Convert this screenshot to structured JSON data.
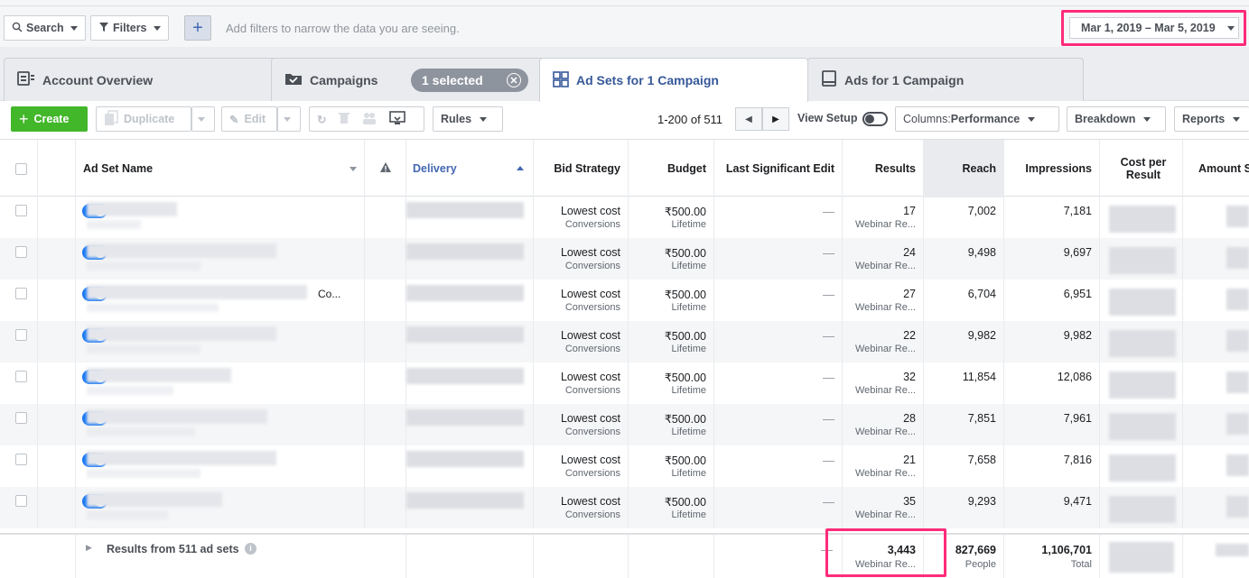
{
  "topbar": {
    "search_label": "Search",
    "filters_label": "Filters",
    "plus_label": "+",
    "filter_hint": "Add filters to narrow the data you are seeing.",
    "date_range": "Mar 1, 2019 – Mar 5, 2019"
  },
  "tabs": {
    "account_overview": "Account Overview",
    "campaigns": "Campaigns",
    "selected_pill": "1 selected",
    "ad_sets": "Ad Sets for 1 Campaign",
    "ads": "Ads for 1 Campaign"
  },
  "toolbar": {
    "create": "Create",
    "duplicate": "Duplicate",
    "edit": "Edit",
    "rules": "Rules",
    "pager": "1-200 of 511",
    "view_setup": "View Setup",
    "columns_prefix": "Columns: ",
    "columns_value": "Performance",
    "breakdown": "Breakdown",
    "reports": "Reports"
  },
  "headers": {
    "name": "Ad Set Name",
    "delivery": "Delivery",
    "bid": "Bid Strategy",
    "budget": "Budget",
    "last_edit": "Last Significant Edit",
    "results": "Results",
    "reach": "Reach",
    "impressions": "Impressions",
    "cost": "Cost per Result",
    "amount": "Amount S"
  },
  "rows": [
    {
      "bid": "Lowest cost",
      "bid_sub": "Conversions",
      "budget": "₹500.00",
      "budget_sub": "Lifetime",
      "edit": "—",
      "results": "17",
      "results_sub": "Webinar Re...",
      "reach": "7,002",
      "impressions": "7,181",
      "name_extra": ""
    },
    {
      "bid": "Lowest cost",
      "bid_sub": "Conversions",
      "budget": "₹500.00",
      "budget_sub": "Lifetime",
      "edit": "—",
      "results": "24",
      "results_sub": "Webinar Re...",
      "reach": "9,498",
      "impressions": "9,697",
      "name_extra": ""
    },
    {
      "bid": "Lowest cost",
      "bid_sub": "Conversions",
      "budget": "₹500.00",
      "budget_sub": "Lifetime",
      "edit": "—",
      "results": "27",
      "results_sub": "Webinar Re...",
      "reach": "6,704",
      "impressions": "6,951",
      "name_extra": "Co..."
    },
    {
      "bid": "Lowest cost",
      "bid_sub": "Conversions",
      "budget": "₹500.00",
      "budget_sub": "Lifetime",
      "edit": "—",
      "results": "22",
      "results_sub": "Webinar Re...",
      "reach": "9,982",
      "impressions": "9,982",
      "name_extra": ""
    },
    {
      "bid": "Lowest cost",
      "bid_sub": "Conversions",
      "budget": "₹500.00",
      "budget_sub": "Lifetime",
      "edit": "—",
      "results": "32",
      "results_sub": "Webinar Re...",
      "reach": "11,854",
      "impressions": "12,086",
      "name_extra": ""
    },
    {
      "bid": "Lowest cost",
      "bid_sub": "Conversions",
      "budget": "₹500.00",
      "budget_sub": "Lifetime",
      "edit": "—",
      "results": "28",
      "results_sub": "Webinar Re...",
      "reach": "7,851",
      "impressions": "7,961",
      "name_extra": ""
    },
    {
      "bid": "Lowest cost",
      "bid_sub": "Conversions",
      "budget": "₹500.00",
      "budget_sub": "Lifetime",
      "edit": "—",
      "results": "21",
      "results_sub": "Webinar Re...",
      "reach": "7,658",
      "impressions": "7,816",
      "name_extra": ""
    },
    {
      "bid": "Lowest cost",
      "bid_sub": "Conversions",
      "budget": "₹500.00",
      "budget_sub": "Lifetime",
      "edit": "—",
      "results": "35",
      "results_sub": "Webinar Re...",
      "reach": "9,293",
      "impressions": "9,471",
      "name_extra": ""
    }
  ],
  "footer": {
    "label": "Results from 511 ad sets",
    "results": "3,443",
    "results_sub": "Webinar Re...",
    "reach": "827,669",
    "reach_sub": "People",
    "impressions": "1,106,701",
    "impressions_sub": "Total",
    "edit_dash": "—"
  },
  "colors": {
    "highlight": "#ff2b7a",
    "toggle_on": "#1877f2",
    "create_green": "#42b72a",
    "link_blue": "#365899"
  },
  "icons": [
    "search-icon",
    "filter-icon",
    "account-overview-icon",
    "campaigns-icon",
    "close-icon",
    "ad-sets-icon",
    "ads-icon",
    "plus-icon",
    "duplicate-icon",
    "edit-icon",
    "refresh-icon",
    "trash-icon",
    "people-icon",
    "compare-icon",
    "warning-icon",
    "info-icon"
  ]
}
